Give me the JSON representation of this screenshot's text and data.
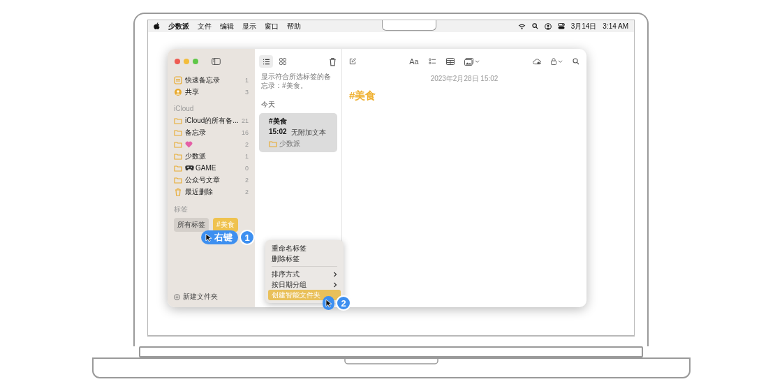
{
  "menu_bar": {
    "app_name": "少数派",
    "menus": [
      "文件",
      "编辑",
      "显示",
      "窗口",
      "帮助"
    ],
    "date": "3月14日",
    "time": "3:14 AM"
  },
  "sidebar": {
    "pinned": [
      {
        "name": "快速备忘录",
        "count": "1",
        "kind": "quick"
      },
      {
        "name": "共享",
        "count": "3",
        "kind": "shared"
      }
    ],
    "section_title": "iCloud",
    "folders": [
      {
        "name": "iCloud的所有备...",
        "count": "21",
        "kind": "folder"
      },
      {
        "name": "备忘录",
        "count": "16",
        "kind": "folder"
      },
      {
        "count": "2",
        "kind": "heart_folder"
      },
      {
        "name": "少数派",
        "count": "1",
        "kind": "folder"
      },
      {
        "name": "GAME",
        "count": "0",
        "kind": "game_folder"
      },
      {
        "name": "公众号文章",
        "count": "2",
        "kind": "folder"
      },
      {
        "name": "最近删除",
        "count": "2",
        "kind": "trash"
      }
    ],
    "tags_title": "标签",
    "tags": [
      {
        "label": "所有标签",
        "selected": false
      },
      {
        "label": "#美食",
        "selected": true
      }
    ],
    "new_folder": "新建文件夹"
  },
  "note_list": {
    "filter_text": "显示符合所选标签的备忘录：#美食。",
    "group": "今天",
    "notes": [
      {
        "title": "#美食",
        "time": "15:02",
        "preview": "无附加文本",
        "folder": "少数派",
        "selected": true
      }
    ]
  },
  "editor": {
    "format_button": "Aa",
    "date": "2023年2月28日 15:02",
    "title": "#美食"
  },
  "context_menu": [
    {
      "kind": "item",
      "label": "重命名标签",
      "selected": false
    },
    {
      "kind": "item",
      "label": "删除标签",
      "selected": false
    },
    {
      "kind": "separator"
    },
    {
      "kind": "submenu",
      "label": "排序方式",
      "selected": false
    },
    {
      "kind": "submenu",
      "label": "按日期分组",
      "selected": false
    },
    {
      "kind": "item",
      "label": "创建智能文件夹",
      "selected": true
    }
  ],
  "callouts": [
    {
      "label": "右键",
      "number": "1"
    },
    {
      "number": "2"
    }
  ]
}
